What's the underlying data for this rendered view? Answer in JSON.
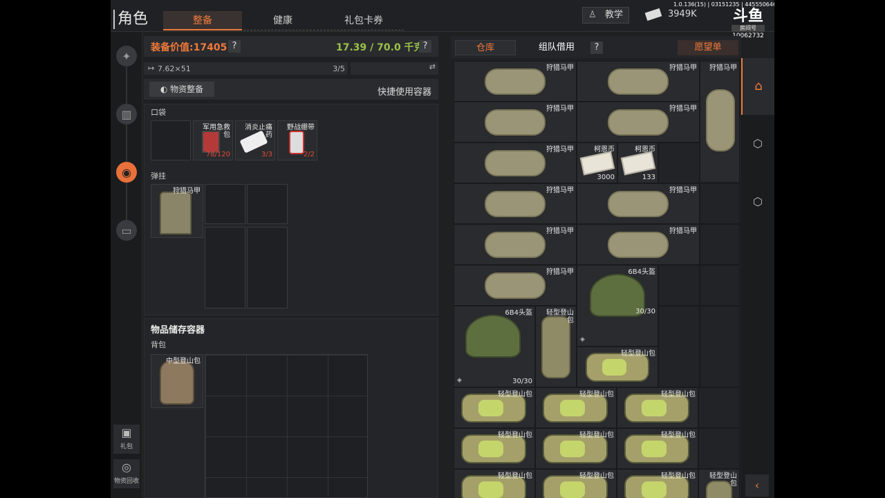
{
  "header": {
    "title": "角色",
    "tabs": [
      {
        "label": "整备",
        "active": true
      },
      {
        "label": "健康",
        "active": false
      },
      {
        "label": "礼包卡券",
        "active": false
      }
    ],
    "tutorial_label": "教学",
    "money": "3949K",
    "version": "1.0.136(15) | 03151235 | 4455506468 | 均衡",
    "logo": "斗鱼",
    "logo_sub": "房间号",
    "room_id": "10062732"
  },
  "left_rail": {
    "icons": [
      "weapon-icon",
      "armor-icon",
      "backpack-icon",
      "container-icon"
    ],
    "buttons": [
      {
        "label": "礼包",
        "icon": "gift-icon"
      },
      {
        "label": "物资回收",
        "icon": "recycle-icon"
      }
    ]
  },
  "loadout": {
    "value_label": "装备价值:17405",
    "weight": "17.39 / 70.0 千克",
    "help": "?",
    "ammo": "7.62×51",
    "ammo_count": "3/5",
    "supply_button": "物资整备",
    "quick_use": "快捷使用容器",
    "pockets_label": "口袋",
    "pocket_items": [
      {
        "name": "",
        "count": ""
      },
      {
        "name": "军用急救包",
        "count": "78/120"
      },
      {
        "name": "消炎止痛药",
        "count": "3/3"
      },
      {
        "name": "野战绷带",
        "count": "2/2"
      }
    ],
    "chest_rig_label": "弹挂",
    "chest_rig_item": "狩猎马甲",
    "storage_title": "物品储存容器",
    "backpack_label": "背包",
    "backpack_item": "中型登山包"
  },
  "stash": {
    "tabs": {
      "storage": "仓库",
      "team": "组队借用",
      "wishlist": "愿望单"
    },
    "help": "?",
    "items": {
      "vest": "狩猎马甲",
      "coin": "柯恩币",
      "coin_counts": [
        "3000",
        "133"
      ],
      "helmet": "6B4头盔",
      "helmet_durability": "30/30",
      "light_pack": "轻型登山包"
    }
  },
  "colors": {
    "accent": "#f07a3c",
    "weight_green": "#9bc34a",
    "count_red": "#e24a3a"
  }
}
